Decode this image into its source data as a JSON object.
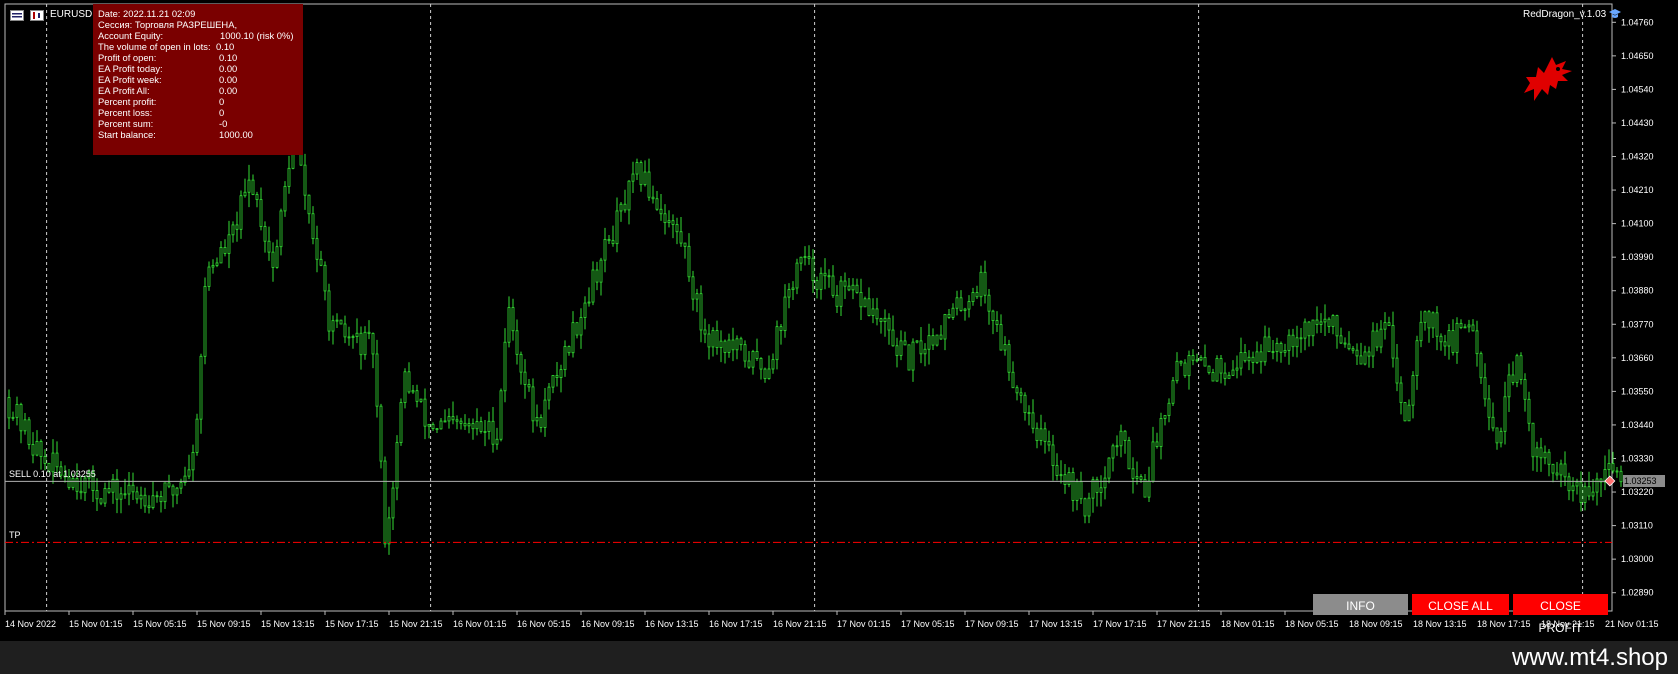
{
  "window": {
    "symbol_title": "EURUSD, M15:  Euro vs US Dollar",
    "ea_name": "RedDragon_v.1.03"
  },
  "info_panel": {
    "rows": [
      {
        "label": "Date: 2022.11.21 02:09",
        "value": ""
      },
      {
        "label": "Сессия: Торговля РАЗРЕШЕНА,",
        "value": ""
      },
      {
        "label": "Account Equity:",
        "value": "1000.10 (risk 0%)"
      },
      {
        "label": "The volume of open in lots:",
        "value": "0.10"
      },
      {
        "label": "Profit of open:",
        "value": "0.10"
      },
      {
        "label": "EA Profit today:",
        "value": "0.00"
      },
      {
        "label": "EA Profit week:",
        "value": "0.00"
      },
      {
        "label": "EA Profit All:",
        "value": "0.00"
      },
      {
        "label": "Percent profit:",
        "value": "0"
      },
      {
        "label": "Percent loss:",
        "value": "0"
      },
      {
        "label": "Percent sum:",
        "value": "-0"
      },
      {
        "label": "Start balance:",
        "value": "1000.00"
      }
    ]
  },
  "chart_lines": {
    "sell_label": "SELL 0.10 at 1.03255",
    "tp_label": "TP",
    "current_price": "1.03253"
  },
  "buttons": {
    "info": "INFO",
    "close_all": "CLOSE ALL",
    "close_profit": "CLOSE PROFIT"
  },
  "footer": {
    "site": "www.mt4.shop"
  },
  "colors": {
    "candle": "#33dd33",
    "panel": "#7a0000",
    "tp_line": "#ff0000",
    "button_red": "#ff0000",
    "button_gray": "#8c8c8c"
  },
  "chart_data": {
    "type": "candlestick",
    "y_ticks": [
      "1.04760",
      "1.04650",
      "1.04540",
      "1.04430",
      "1.04320",
      "1.04210",
      "1.04100",
      "1.03990",
      "1.03880",
      "1.03770",
      "1.03660",
      "1.03550",
      "1.03440",
      "1.03330",
      "1.03220",
      "1.03110",
      "1.03000",
      "1.02890"
    ],
    "x_ticks": [
      "14 Nov 2022",
      "15 Nov 01:15",
      "15 Nov 05:15",
      "15 Nov 09:15",
      "15 Nov 13:15",
      "15 Nov 17:15",
      "15 Nov 21:15",
      "16 Nov 01:15",
      "16 Nov 05:15",
      "16 Nov 09:15",
      "16 Nov 13:15",
      "16 Nov 17:15",
      "16 Nov 21:15",
      "17 Nov 01:15",
      "17 Nov 05:15",
      "17 Nov 09:15",
      "17 Nov 13:15",
      "17 Nov 17:15",
      "17 Nov 21:15",
      "18 Nov 01:15",
      "18 Nov 05:15",
      "18 Nov 09:15",
      "18 Nov 13:15",
      "18 Nov 17:15",
      "18 Nov 21:15",
      "21 Nov 01:15"
    ],
    "ylim": [
      1.0283,
      1.0482
    ],
    "sell_price": 1.03255,
    "tp_price": 1.03055,
    "close_path": [
      {
        "t": 0,
        "price": 1.0353
      },
      {
        "t": 0.6,
        "price": 1.0332
      },
      {
        "t": 1.5,
        "price": 1.0322
      },
      {
        "t": 2.6,
        "price": 1.0321
      },
      {
        "t": 2.95,
        "price": 1.0334
      },
      {
        "t": 3.15,
        "price": 1.0395
      },
      {
        "t": 3.5,
        "price": 1.0403
      },
      {
        "t": 3.85,
        "price": 1.0425
      },
      {
        "t": 4.2,
        "price": 1.0395
      },
      {
        "t": 4.5,
        "price": 1.044
      },
      {
        "t": 5.1,
        "price": 1.0375
      },
      {
        "t": 5.75,
        "price": 1.0369
      },
      {
        "t": 5.95,
        "price": 1.0305
      },
      {
        "t": 6.25,
        "price": 1.036
      },
      {
        "t": 6.6,
        "price": 1.0344
      },
      {
        "t": 7.7,
        "price": 1.0342
      },
      {
        "t": 7.85,
        "price": 1.0383
      },
      {
        "t": 8.3,
        "price": 1.0343
      },
      {
        "t": 9.25,
        "price": 1.0395
      },
      {
        "t": 9.9,
        "price": 1.0427
      },
      {
        "t": 10.6,
        "price": 1.0403
      },
      {
        "t": 10.9,
        "price": 1.0375
      },
      {
        "t": 11.9,
        "price": 1.0362
      },
      {
        "t": 12.4,
        "price": 1.0398
      },
      {
        "t": 13.0,
        "price": 1.0387
      },
      {
        "t": 13.4,
        "price": 1.0385
      },
      {
        "t": 14.1,
        "price": 1.0365
      },
      {
        "t": 14.8,
        "price": 1.038
      },
      {
        "t": 15.25,
        "price": 1.0391
      },
      {
        "t": 15.8,
        "price": 1.0357
      },
      {
        "t": 16.3,
        "price": 1.0335
      },
      {
        "t": 16.9,
        "price": 1.0317
      },
      {
        "t": 17.4,
        "price": 1.034
      },
      {
        "t": 17.8,
        "price": 1.0323
      },
      {
        "t": 18.3,
        "price": 1.0365
      },
      {
        "t": 18.9,
        "price": 1.0362
      },
      {
        "t": 19.6,
        "price": 1.0368
      },
      {
        "t": 20.2,
        "price": 1.0375
      },
      {
        "t": 20.6,
        "price": 1.0378
      },
      {
        "t": 21.2,
        "price": 1.0368
      },
      {
        "t": 21.6,
        "price": 1.0375
      },
      {
        "t": 21.9,
        "price": 1.0345
      },
      {
        "t": 22.1,
        "price": 1.0382
      },
      {
        "t": 22.6,
        "price": 1.037
      },
      {
        "t": 22.9,
        "price": 1.038
      },
      {
        "t": 23.3,
        "price": 1.0338
      },
      {
        "t": 23.6,
        "price": 1.0365
      },
      {
        "t": 23.9,
        "price": 1.0335
      },
      {
        "t": 24.4,
        "price": 1.0325
      },
      {
        "t": 24.7,
        "price": 1.0319
      },
      {
        "t": 25.0,
        "price": 1.0328
      },
      {
        "t": 25.3,
        "price": 1.0329
      }
    ]
  }
}
